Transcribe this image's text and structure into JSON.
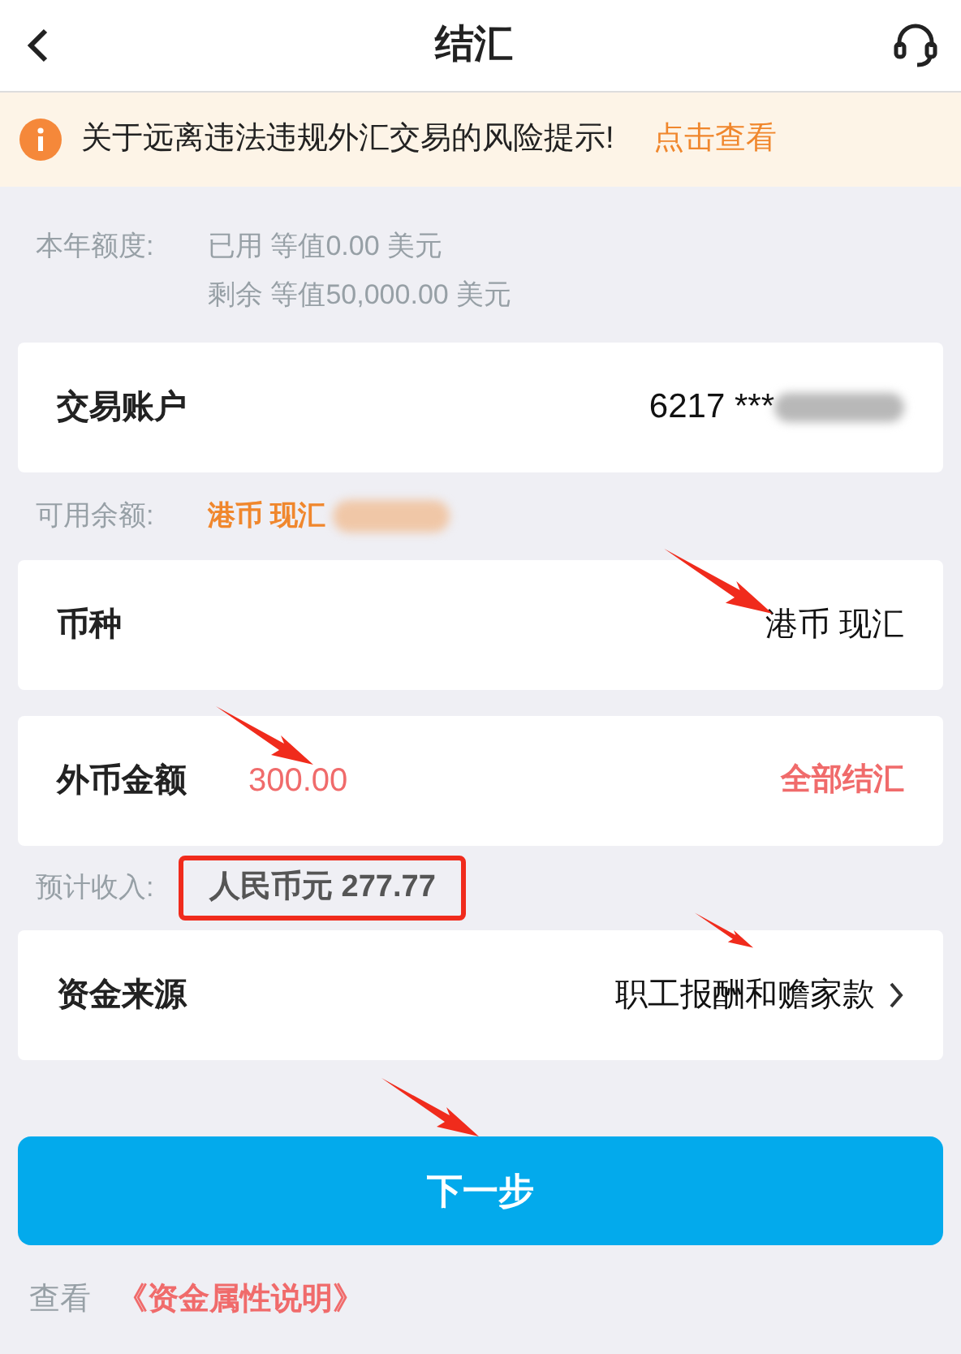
{
  "header": {
    "title": "结汇"
  },
  "notice": {
    "text": "关于远离违法违规外汇交易的风险提示!",
    "link": "点击查看"
  },
  "quota": {
    "label": "本年额度:",
    "lines": [
      "已用 等值0.00 美元",
      "剩余 等值50,000.00 美元"
    ]
  },
  "account": {
    "label": "交易账户",
    "value": "6217 ***"
  },
  "balance": {
    "label": "可用余额:",
    "value": "港币 现汇"
  },
  "currency": {
    "label": "币种",
    "value": "港币 现汇"
  },
  "amount": {
    "label": "外币金额",
    "value": "300.00",
    "action": "全部结汇"
  },
  "estimate": {
    "label": "预计收入:",
    "value": "人民币元 277.77"
  },
  "source": {
    "label": "资金来源",
    "value": "职工报酬和赡家款"
  },
  "next_button": "下一步",
  "footer": {
    "prefix": "查看",
    "link": "《资金属性说明》"
  }
}
